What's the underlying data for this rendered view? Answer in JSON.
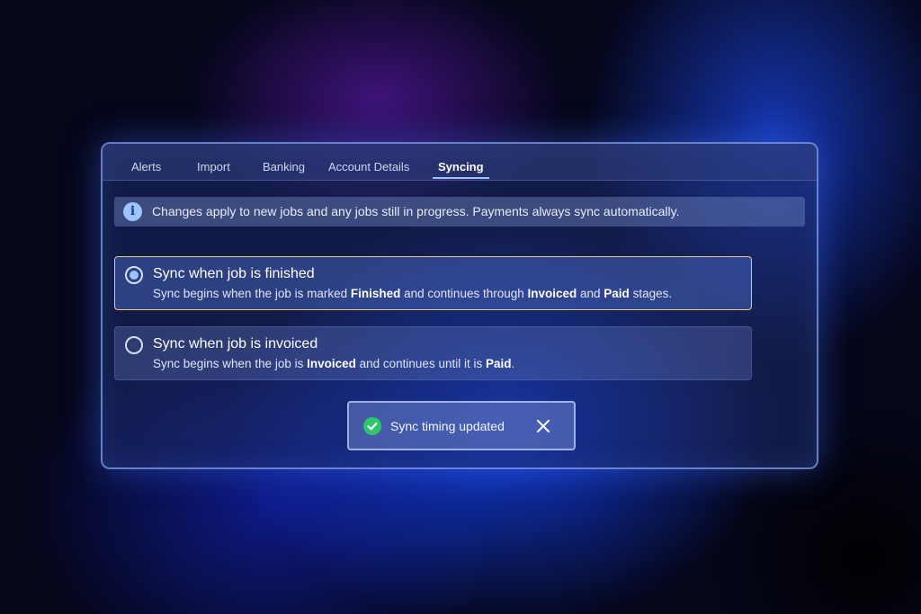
{
  "tabs": [
    {
      "label": "Alerts",
      "active": false
    },
    {
      "label": "Import",
      "active": false
    },
    {
      "label": "Banking",
      "active": false
    },
    {
      "label": "Account Details",
      "active": false
    },
    {
      "label": "Syncing",
      "active": true
    }
  ],
  "info": {
    "icon": "info-icon",
    "text": "Changes apply to new jobs and any jobs still in progress. Payments always sync automatically."
  },
  "options": [
    {
      "title": "Sync when job is finished",
      "selected": true,
      "desc_parts": [
        "Sync begins when the job is marked ",
        "Finished",
        " and continues through ",
        "Invoiced",
        " and ",
        "Paid",
        " stages."
      ]
    },
    {
      "title": "Sync when job is invoiced",
      "selected": false,
      "desc_parts": [
        "Sync begins when the job is ",
        "Invoiced",
        " and continues until it is ",
        "Paid",
        "."
      ]
    }
  ],
  "toast": {
    "message": "Sync timing updated",
    "icon": "check-circle-icon",
    "close_icon": "close-icon"
  },
  "colors": {
    "selected_border": "#e8cc7c",
    "radio_dot": "#9fc2ff",
    "success": "#2fc56c",
    "info": "#9cc4ff"
  }
}
